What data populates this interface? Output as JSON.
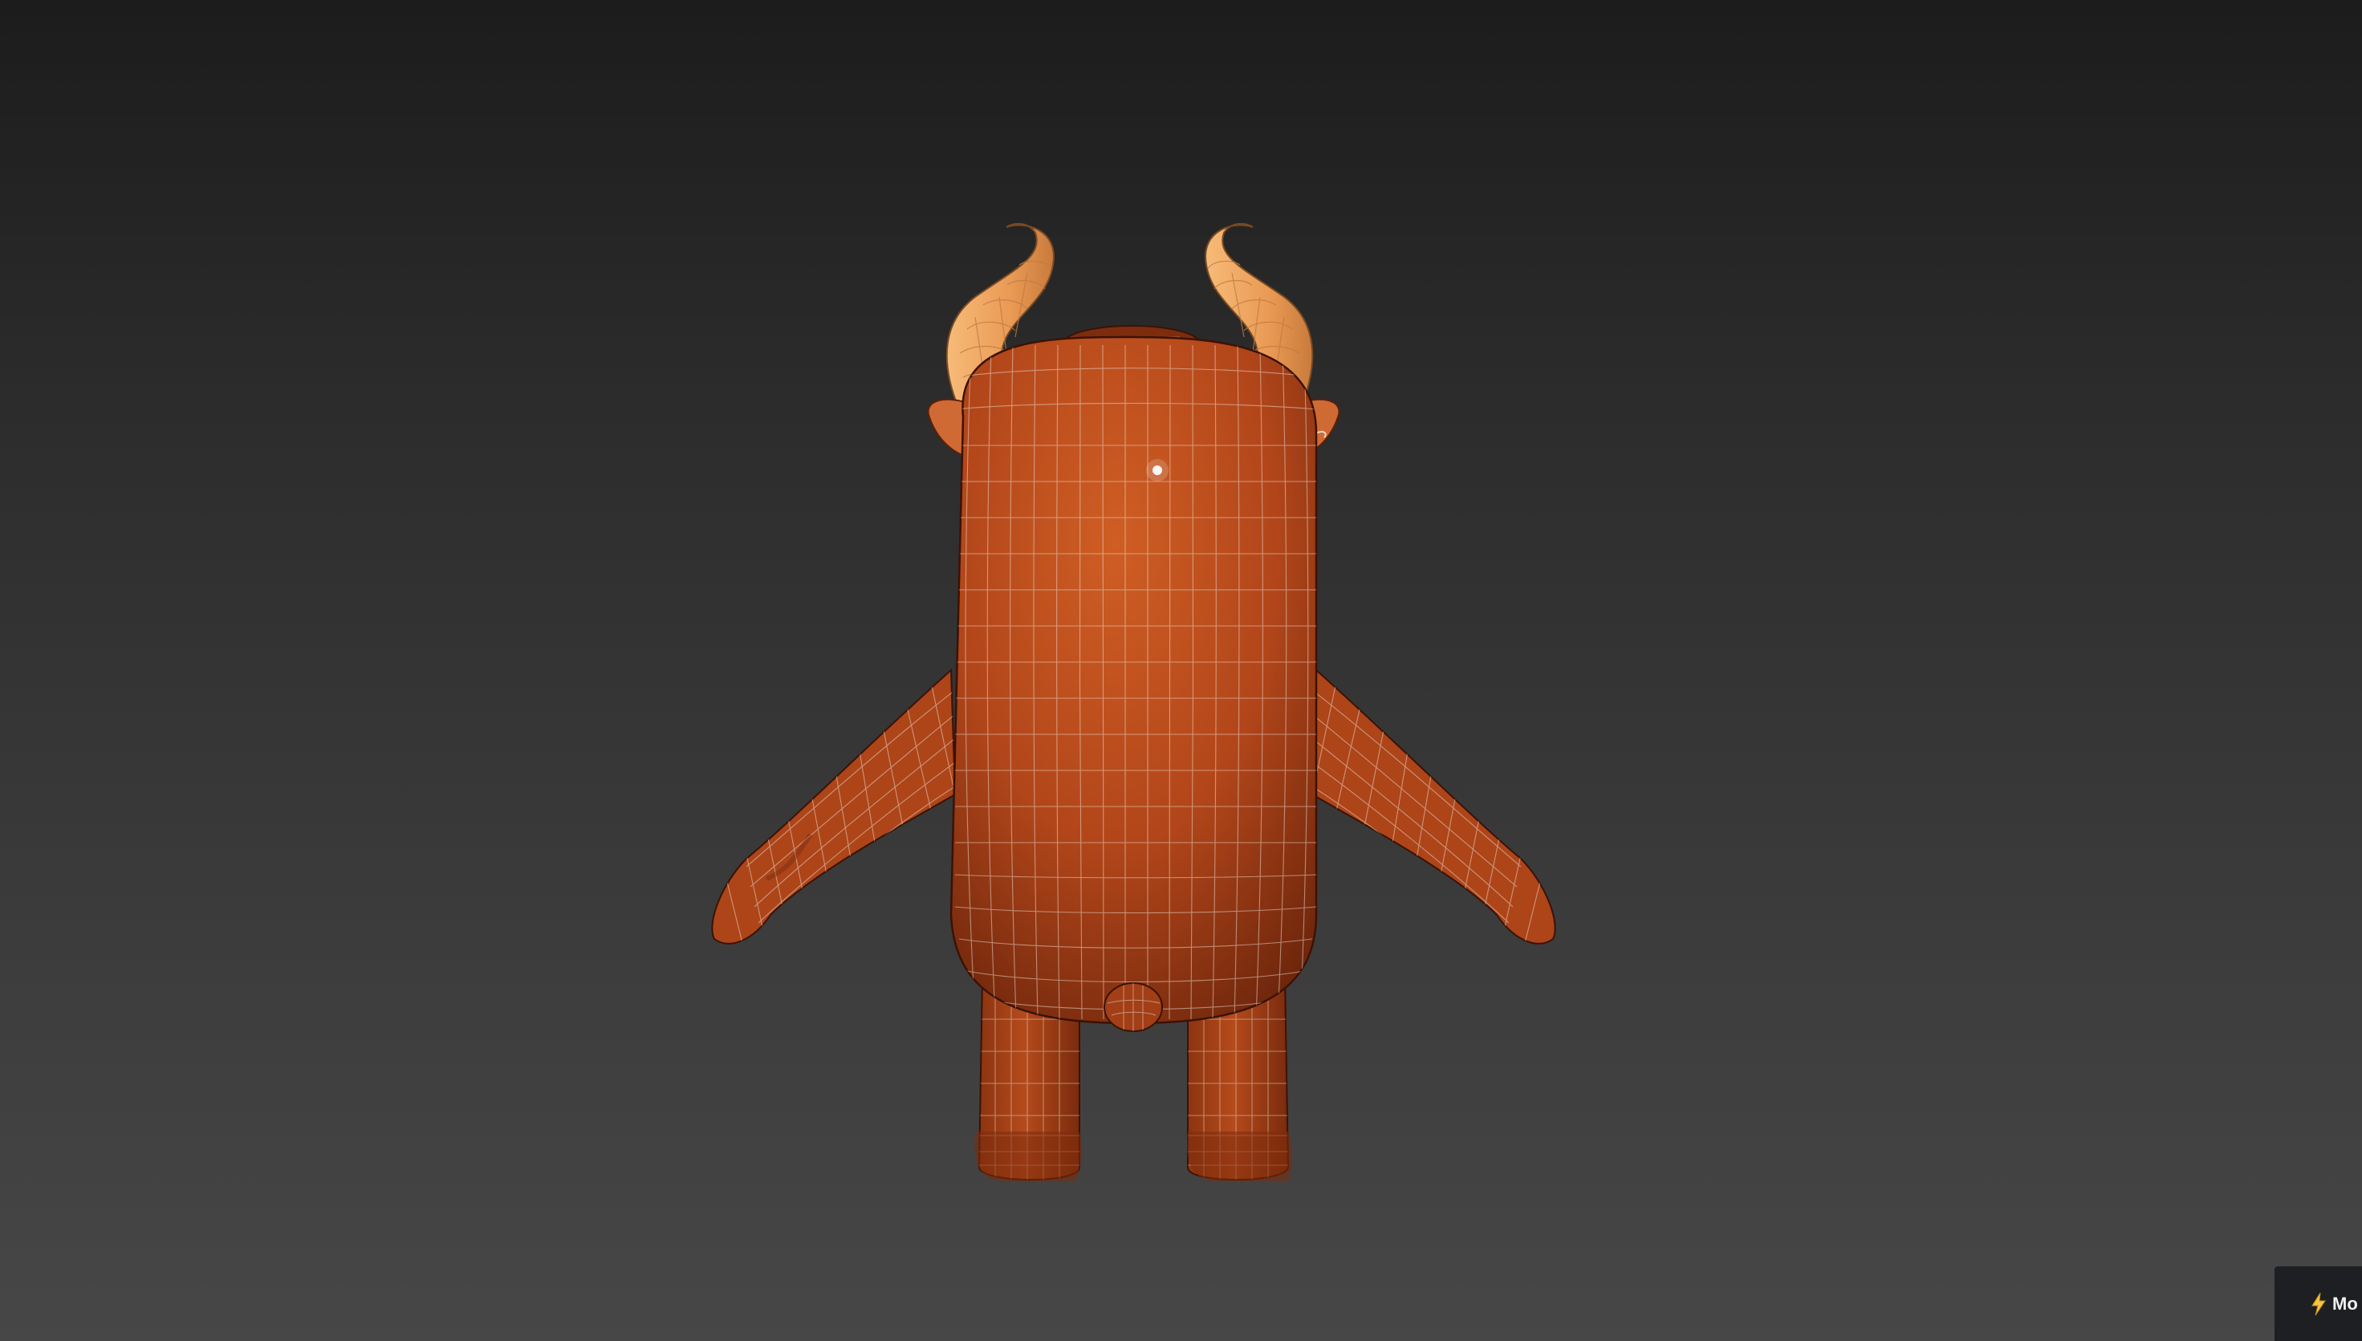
{
  "viewport": {
    "background_top": "#1c1c1c",
    "background_bottom": "#474747"
  },
  "model": {
    "body_color": "#c0531f",
    "body_shadow_color": "#7e2e0e",
    "horn_color": "#f2a561",
    "wire_color": "#e9d7cc"
  },
  "badge": {
    "icon": "lightning-icon",
    "label": "Mo"
  }
}
